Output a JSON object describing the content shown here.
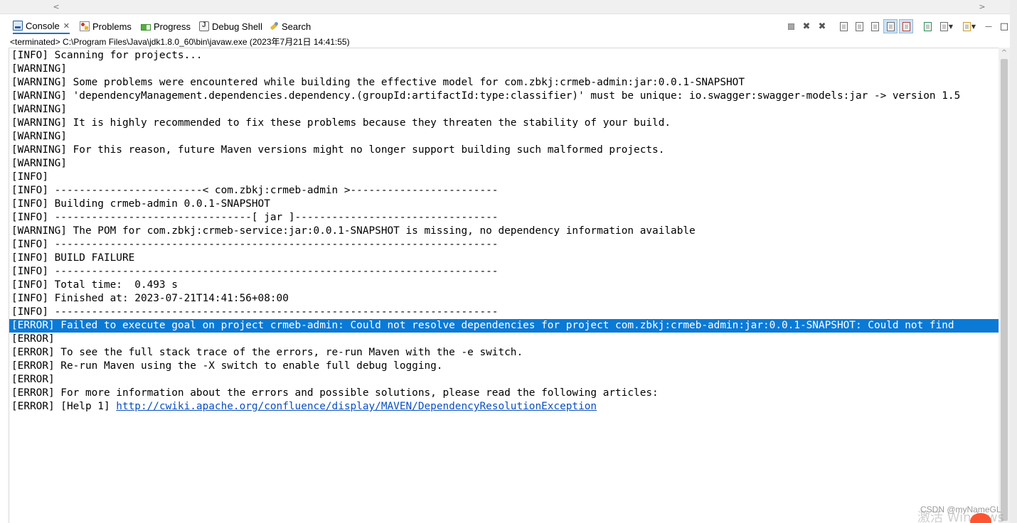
{
  "top_scrollbar": {
    "left_arrow": "<",
    "right_arrow": ">"
  },
  "tabs": [
    {
      "label": "Console",
      "icon": "console-icon",
      "close": "✕",
      "active": true
    },
    {
      "label": "Problems",
      "icon": "problems-icon"
    },
    {
      "label": "Progress",
      "icon": "progress-icon"
    },
    {
      "label": "Debug Shell",
      "icon": "debug-shell-icon"
    },
    {
      "label": "Search",
      "icon": "search-icon"
    }
  ],
  "toolbar": {
    "icons": [
      "terminate-icon",
      "remove-launch-icon",
      "remove-all-terminated-icon",
      "clear-console-icon",
      "scroll-lock-icon",
      "word-wrap-icon",
      "show-on-stdout-icon",
      "show-on-stderr-icon",
      "pin-console-icon",
      "display-console-icon",
      "open-console-icon",
      "minimize-icon",
      "maximize-icon"
    ],
    "minimize": "—",
    "maximize": "□"
  },
  "terminated_label": "<terminated> C:\\Program Files\\Java\\jdk1.8.0_60\\bin\\javaw.exe (2023年7月21日 14:41:55)",
  "console": {
    "lines": [
      "[INFO] Scanning for projects...",
      "[WARNING]",
      "[WARNING] Some problems were encountered while building the effective model for com.zbkj:crmeb-admin:jar:0.0.1-SNAPSHOT",
      "[WARNING] 'dependencyManagement.dependencies.dependency.(groupId:artifactId:type:classifier)' must be unique: io.swagger:swagger-models:jar -> version 1.5",
      "[WARNING]",
      "[WARNING] It is highly recommended to fix these problems because they threaten the stability of your build.",
      "[WARNING]",
      "[WARNING] For this reason, future Maven versions might no longer support building such malformed projects.",
      "[WARNING]",
      "[INFO]",
      "[INFO] ------------------------< com.zbkj:crmeb-admin >------------------------",
      "[INFO] Building crmeb-admin 0.0.1-SNAPSHOT",
      "[INFO] --------------------------------[ jar ]---------------------------------",
      "[WARNING] The POM for com.zbkj:crmeb-service:jar:0.0.1-SNAPSHOT is missing, no dependency information available",
      "[INFO] ------------------------------------------------------------------------",
      "[INFO] BUILD FAILURE",
      "[INFO] ------------------------------------------------------------------------",
      "[INFO] Total time:  0.493 s",
      "[INFO] Finished at: 2023-07-21T14:41:56+08:00",
      "[INFO] ------------------------------------------------------------------------",
      "[ERROR] Failed to execute goal on project crmeb-admin: Could not resolve dependencies for project com.zbkj:crmeb-admin:jar:0.0.1-SNAPSHOT: Could not find",
      "[ERROR]",
      "[ERROR] To see the full stack trace of the errors, re-run Maven with the -e switch.",
      "[ERROR] Re-run Maven using the -X switch to enable full debug logging.",
      "[ERROR]",
      "[ERROR] For more information about the errors and possible solutions, please read the following articles:",
      "[ERROR] [Help 1] "
    ],
    "help_link": "http://cwiki.apache.org/confluence/display/MAVEN/DependencyResolutionException",
    "selection_color": "#0a7ad6"
  },
  "scrollbar": {
    "up_arrow": "^"
  },
  "watermark": "CSDN @myNameGL",
  "activate_text": "激活 Windows"
}
